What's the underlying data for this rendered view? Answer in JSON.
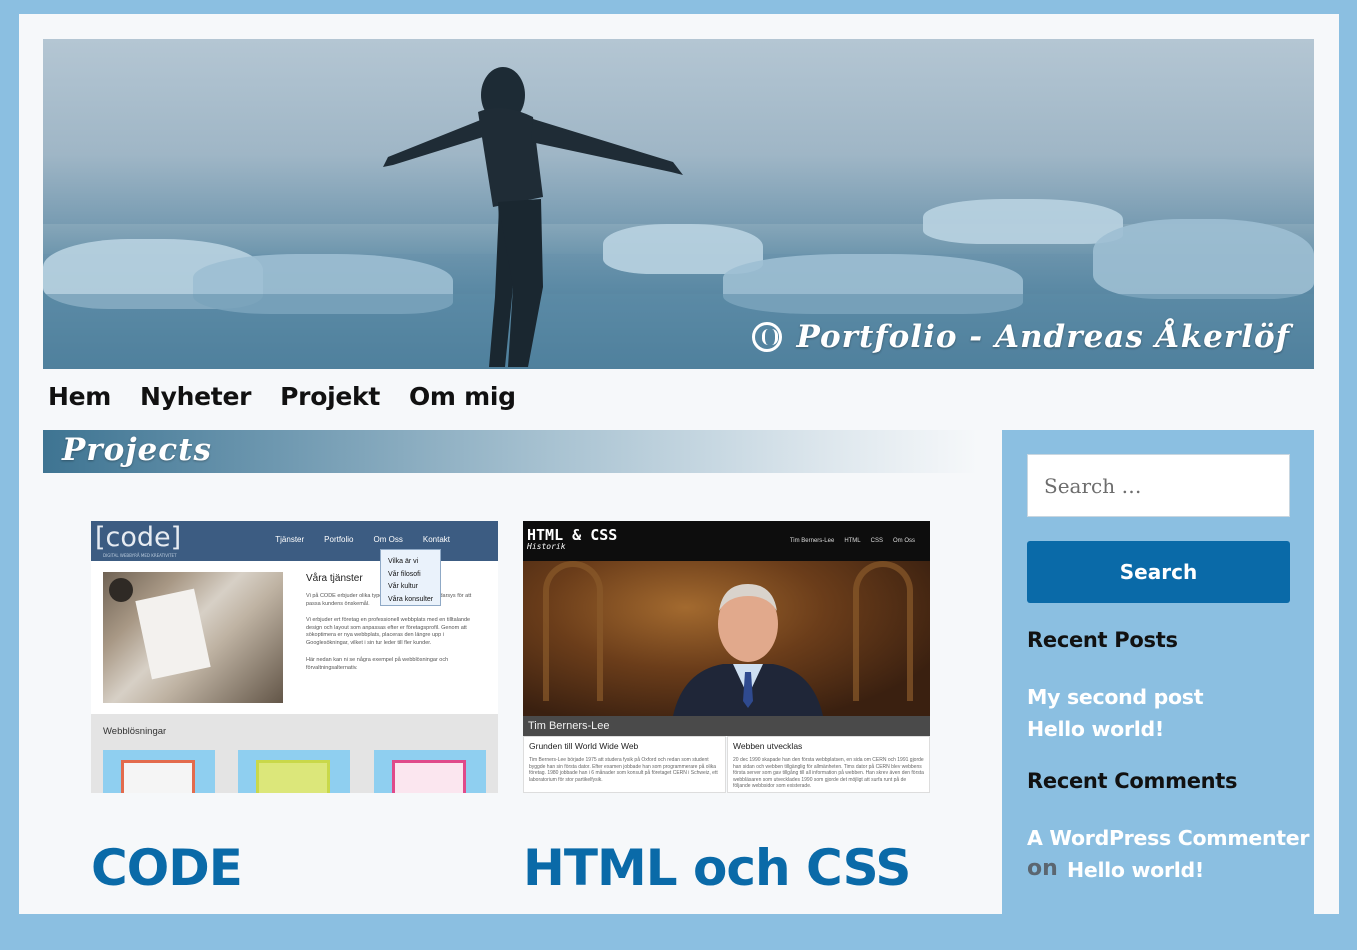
{
  "site": {
    "title": "Portfolio - Andreas Åkerlöf"
  },
  "nav": {
    "items": [
      {
        "label": "Hem"
      },
      {
        "label": "Nyheter"
      },
      {
        "label": "Projekt"
      },
      {
        "label": "Om mig"
      }
    ]
  },
  "section": {
    "title": "Projects"
  },
  "projects": [
    {
      "title": "CODE",
      "thumb": {
        "logo": "[code]",
        "tagline": "DIGITAL WEBBYRÅ MED KREATIVITET",
        "menu": [
          "Tjänster",
          "Portfolio",
          "Om Oss",
          "Kontakt"
        ],
        "dropdown": [
          "Vilka är vi",
          "Vår filosofi",
          "Vår kultur",
          "Våra konsulter"
        ],
        "heading": "Våra tjänster",
        "p1": "Vi på CODE erbjuder olika typer av tjänster inom skräddarsys för att passa kundens önskemål.",
        "p2": "Vi erbjuder ert företag en professionell webbplats med en tilltalande design och layout som anpassas efter er företagsprofil. Genom att sökoptimera er nya webbplats, placeras den längre upp i Googlesökningar, vilket i sin tur leder till fler kunder.",
        "p3": "Här nedan kan ni se några exempel på webblösningar och förvaltningsalternativ.",
        "section": "Webblösningar"
      }
    },
    {
      "title": "HTML och CSS",
      "thumb": {
        "logo": "HTML & CSS",
        "logo_sub": "Historik",
        "menu": [
          "Tim Berners-Lee",
          "HTML",
          "CSS",
          "Om Oss"
        ],
        "caption": "Tim Berners-Lee",
        "col1_title": "Grunden till World Wide Web",
        "col1_text": "Tim Berners-Lee började 1975 att studera fysik på Oxford och redan som student byggde han sin första dator. Efter examen jobbade han som programmerare på olika företag. 1980 jobbade han i 6 månader som konsult på företaget CERN i Schweiz, ett laboratorium för stor partikelfysik.",
        "col2_title": "Webben utvecklas",
        "col2_text": "20 dec 1990 skapade han den första webbplatsen, en sida om CERN och 1991 gjorde han sidan och webben tillgänglig för allmänheten. Tims dator på CERN blev webbens första server som gav tillgång till all information på webben. Han skrev även den första webbläsaren som utvecklades 1990 som gjorde det möjligt att surfa runt på de följande webbsidor som existerade."
      }
    }
  ],
  "sidebar": {
    "search_placeholder": "Search …",
    "search_button": "Search",
    "recent_posts_title": "Recent Posts",
    "recent_posts": [
      "My second post",
      "Hello world!"
    ],
    "recent_comments_title": "Recent Comments",
    "recent_comment_author": "A WordPress Commenter",
    "recent_comment_on": "on",
    "recent_comment_post": "Hello world!"
  },
  "colors": {
    "background": "#8bbfe1",
    "page": "#f6f8fa",
    "accent": "#0a6aa8",
    "sidebar": "#8bbfe1"
  }
}
